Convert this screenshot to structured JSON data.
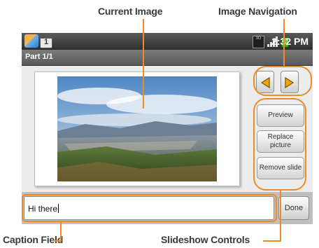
{
  "callouts": {
    "current_image": "Current Image",
    "image_navigation": "Image Navigation",
    "caption_field": "Caption Field",
    "slideshow_controls": "Slideshow Controls"
  },
  "statusbar": {
    "network": "3G",
    "time": "2:32 PM",
    "calendar_day": "1"
  },
  "titlebar": {
    "title": "Part 1/1"
  },
  "slideshow_controls": {
    "preview": "Preview",
    "replace_picture": "Replace picture",
    "remove_slide": "Remove slide"
  },
  "caption": {
    "value": "Hi there"
  },
  "done_label": "Done",
  "icons": {
    "prev": "left-arrow-icon",
    "next": "right-arrow-icon"
  },
  "colors": {
    "callout_line": "#f08a24",
    "arrow_fill": "#f0a800"
  }
}
